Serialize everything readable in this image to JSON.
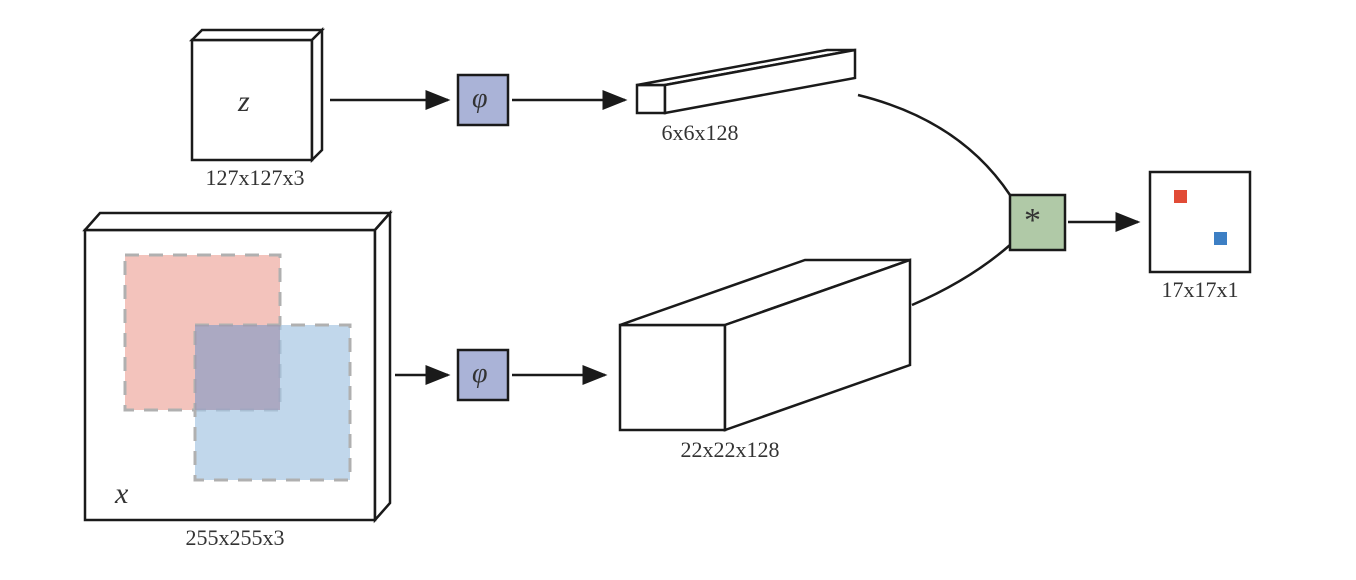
{
  "inputs": {
    "z": {
      "symbol": "z",
      "dims": "127x127x3"
    },
    "x": {
      "symbol": "x",
      "dims": "255x255x3"
    }
  },
  "operators": {
    "phi1": "φ",
    "phi2": "φ",
    "conv": "*"
  },
  "features": {
    "z_out": "6x6x128",
    "x_out": "22x22x128"
  },
  "output": {
    "dims": "17x17x1"
  },
  "colors": {
    "phi_fill": "#aab3d7",
    "conv_fill": "#b0c9a7",
    "red_patch": "#eea9a0",
    "blue_patch": "#a6c6e2",
    "red_dot": "#e14b36",
    "blue_dot": "#3d7fc4",
    "dash": "#b0b0b0",
    "stroke": "#1a1a1a"
  }
}
